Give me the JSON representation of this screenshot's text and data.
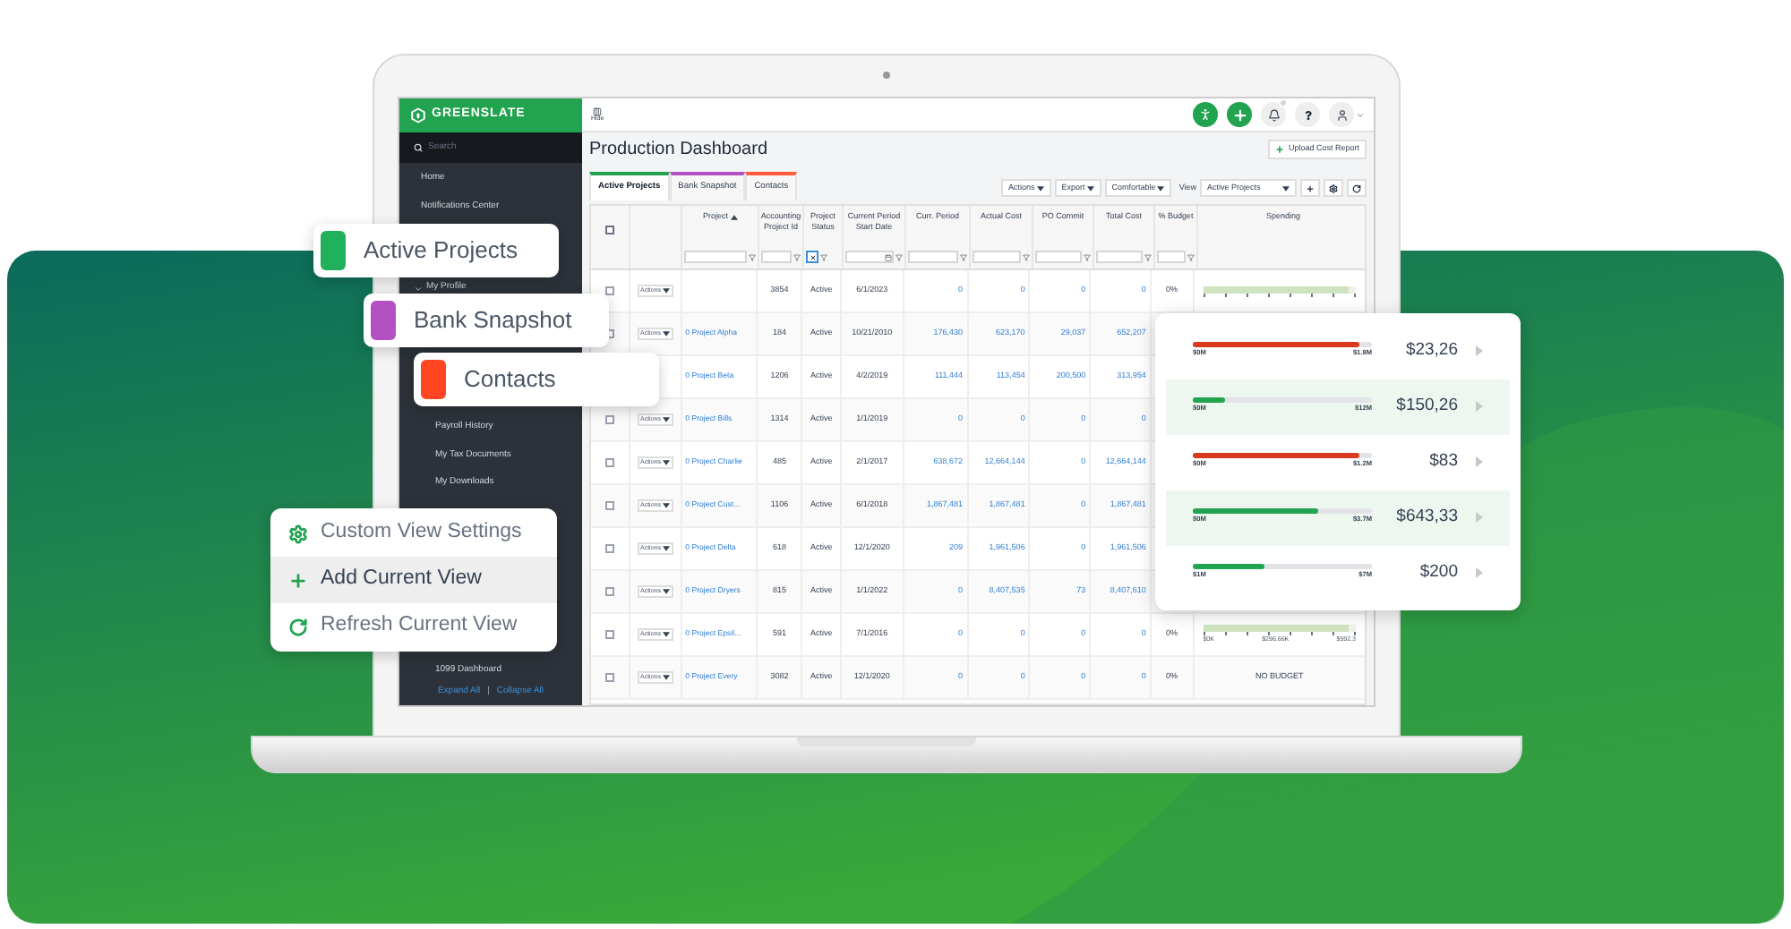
{
  "sidebar": {
    "logo": "GREENSLATE",
    "search": {
      "placeholder": "Search"
    },
    "items": [
      {
        "label": "Home"
      },
      {
        "label": "Notifications Center"
      }
    ],
    "profile": {
      "label": "My Profile",
      "expanded": true,
      "children": [
        {
          "label": "Payroll History"
        },
        {
          "label": "My Tax Documents"
        },
        {
          "label": "My Downloads"
        }
      ]
    },
    "footer_item": {
      "label": "1099 Dashboard"
    },
    "expand_all": "Expand All",
    "separator": "|",
    "collapse_all": "Collapse All"
  },
  "top_bar": {
    "hide": "Hide"
  },
  "page": {
    "title": "Production Dashboard",
    "upload_button": "Upload Cost Report"
  },
  "tabs": [
    {
      "label": "Active Projects",
      "color": "#22a350",
      "selected": true
    },
    {
      "label": "Bank Snapshot",
      "color": "#b44fc4",
      "selected": false
    },
    {
      "label": "Contacts",
      "color": "#ff5a3c",
      "selected": false
    }
  ],
  "toolbar": {
    "buttons": [
      "Actions",
      "Export",
      "Comfortable"
    ],
    "view_label": "View",
    "view_value": "Active Projects"
  },
  "table": {
    "select_all": {
      "checked": false
    },
    "columns": [
      {
        "kind": "check"
      },
      {
        "kind": "actions"
      },
      {
        "label": "Project",
        "sorted": true,
        "kind": "text_filter"
      },
      {
        "label": "Accounting Project Id",
        "kind": "text_filter"
      },
      {
        "label": "Project Status",
        "kind": "cleared_filter"
      },
      {
        "label": "Current Period Start Date",
        "kind": "date_filter"
      },
      {
        "label": "Curr. Period",
        "kind": "text_filter"
      },
      {
        "label": "Actual Cost",
        "kind": "text_filter"
      },
      {
        "label": "PO Commit",
        "kind": "text_filter"
      },
      {
        "label": "Total Cost",
        "kind": "text_filter"
      },
      {
        "label": "% Budget",
        "kind": "text_filter"
      },
      {
        "label": "Spending",
        "kind": "plain"
      }
    ],
    "rows": [
      {
        "checked": false,
        "action": "Actions",
        "id": "3854",
        "status": "Active",
        "date": "6/1/2023",
        "curr": "0",
        "actual": "0",
        "po": "0",
        "total": "0",
        "budget": "0%",
        "spending": {
          "kind": "bar",
          "level": 0.95
        }
      },
      {
        "checked": false,
        "action": "Actions",
        "project": "0 Project Alpha",
        "id": "184",
        "status": "Active",
        "date": "10/21/2010",
        "curr": "176,430",
        "actual": "623,170",
        "po": "29,037",
        "total": "652,207"
      },
      {
        "project": "0 Project Beta",
        "id": "1206",
        "status": "Active",
        "date": "4/2/2019",
        "curr": "111,444",
        "actual": "113,454",
        "po": "200,500",
        "total": "313,954"
      },
      {
        "checked": false,
        "action": "Actions",
        "project": "0 Project Bills",
        "id": "1314",
        "status": "Active",
        "date": "1/1/2019",
        "curr": "0",
        "actual": "0",
        "po": "0",
        "total": "0"
      },
      {
        "checked": false,
        "action": "Actions",
        "project": "0 Project Charlie",
        "id": "485",
        "status": "Active",
        "date": "2/1/2017",
        "curr": "638,672",
        "actual": "12,664,144",
        "po": "0",
        "total": "12,664,144"
      },
      {
        "checked": false,
        "action": "Actions",
        "project": "0 Project Cust...",
        "id": "1106",
        "status": "Active",
        "date": "6/1/2018",
        "curr": "1,867,481",
        "actual": "1,867,481",
        "po": "0",
        "total": "1,867,481"
      },
      {
        "checked": false,
        "action": "Actions",
        "project": "0 Project Delta",
        "id": "618",
        "status": "Active",
        "date": "12/1/2020",
        "curr": "209",
        "actual": "1,961,506",
        "po": "0",
        "total": "1,961,506"
      },
      {
        "checked": false,
        "action": "Actions",
        "project": "0 Project Dryers",
        "id": "815",
        "status": "Active",
        "date": "1/1/2022",
        "curr": "0",
        "actual": "8,407,535",
        "po": "73",
        "total": "8,407,610"
      },
      {
        "checked": false,
        "action": "Actions",
        "project": "0 Project Epsil...",
        "id": "591",
        "status": "Active",
        "date": "7/1/2016",
        "curr": "0",
        "actual": "0",
        "po": "0",
        "total": "0",
        "budget": "0%",
        "spending": {
          "kind": "bar",
          "level": 0.95,
          "labels": [
            "$0K",
            "$296.66K",
            "$592.3"
          ]
        }
      },
      {
        "checked": false,
        "action": "Actions",
        "project": "0 Project Every",
        "id": "3082",
        "status": "Active",
        "date": "12/1/2020",
        "curr": "0",
        "actual": "0",
        "po": "0",
        "total": "0",
        "budget": "0%",
        "spending": {
          "kind": "text",
          "text": "NO BUDGET"
        }
      }
    ]
  },
  "floating_tabs": [
    {
      "label": "Active Projects",
      "color": "#22b15b"
    },
    {
      "label": "Bank Snapshot",
      "color": "#b44fc4"
    },
    {
      "label": "Contacts",
      "color": "#ff4522"
    }
  ],
  "view_menu": [
    {
      "label": "Custom View Settings",
      "selected": false
    },
    {
      "label": "Add Current View",
      "selected": true
    },
    {
      "label": "Refresh Current View",
      "selected": false
    }
  ],
  "spending_card": [
    {
      "level": 0.93,
      "color": "#d93a1e",
      "min": "$0M",
      "max": "$1.8M",
      "amount": "$23,26",
      "highlighted": false
    },
    {
      "level": 0.18,
      "color": "#22a350",
      "min": "$0M",
      "max": "$12M",
      "amount": "$150,26",
      "highlighted": true
    },
    {
      "level": 0.93,
      "color": "#d93a1e",
      "min": "$0M",
      "max": "$1.2M",
      "amount": "$83",
      "highlighted": false
    },
    {
      "level": 0.7,
      "color": "#22a350",
      "min": "$0M",
      "max": "$3.7M",
      "amount": "$643,33",
      "highlighted": true
    },
    {
      "level": 0.4,
      "color": "#22a350",
      "min": "$1M",
      "max": "$7M",
      "amount": "$200",
      "highlighted": false
    }
  ]
}
